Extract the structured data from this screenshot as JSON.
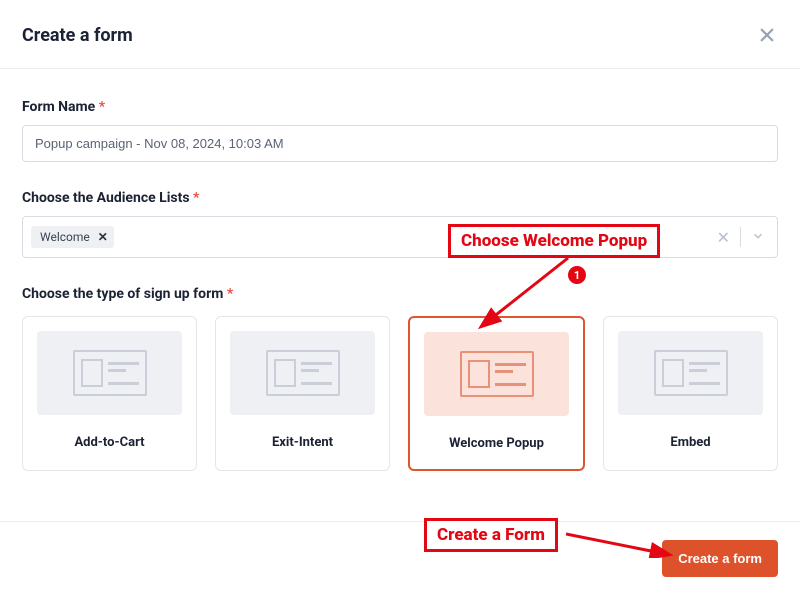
{
  "header": {
    "title": "Create a form"
  },
  "form_name": {
    "label": "Form Name",
    "value": "Popup campaign - Nov 08, 2024, 10:03 AM"
  },
  "audience": {
    "label": "Choose the Audience Lists",
    "tags": [
      "Welcome"
    ]
  },
  "form_type": {
    "label": "Choose the type of sign up form",
    "options": [
      {
        "label": "Add-to-Cart",
        "selected": false
      },
      {
        "label": "Exit-Intent",
        "selected": false
      },
      {
        "label": "Welcome Popup",
        "selected": true
      },
      {
        "label": "Embed",
        "selected": false
      }
    ]
  },
  "footer": {
    "create_label": "Create a form"
  },
  "annotations": {
    "choose_popup": "Choose Welcome Popup",
    "create_form": "Create a Form",
    "badge": "1"
  }
}
